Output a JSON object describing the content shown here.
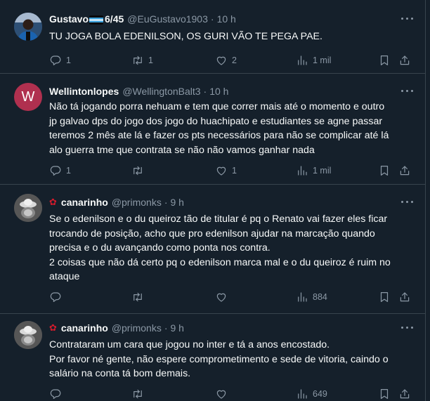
{
  "tweets": [
    {
      "name_pre": "Gustavo",
      "name_post": "6/45",
      "name_has_flag": true,
      "handle": "@EuGustavo1903",
      "time": "10 h",
      "lines": [
        "TU JOGA BOLA EDENILSON, OS GURI VÃO TE PEGA PAE."
      ],
      "replies": "1",
      "retweets": "1",
      "likes": "2",
      "views": "1 mil"
    },
    {
      "name": "Wellintonlopes",
      "avatar_letter": "W",
      "handle": "@WellingtonBalt3",
      "time": "10 h",
      "lines": [
        "Não tá jogando porra nehuam e tem que correr mais até o momento e outro",
        "jp galvao dps do jogo dos jogo do huachipato e estudiantes se agne passar",
        "teremos 2 mês ate lá e fazer os pts necessários para não se complicar até lá",
        "alo guerra tme que contrata se não não vamos ganhar nada"
      ],
      "replies": "1",
      "retweets": "",
      "likes": "1",
      "views": "1 mil"
    },
    {
      "name": "canarinho",
      "handle": "@primonks",
      "time": "9 h",
      "lines": [
        "Se o edenilson e o du queiroz tão de titular é pq o Renato vai fazer eles ficar",
        "trocando de posição, acho que pro edenilson ajudar na marcação quando",
        "precisa e o du avançando como ponta nos contra.",
        "2 coisas que não dá certo pq o edenilson marca mal e o du queiroz é ruim no",
        "ataque"
      ],
      "replies": "",
      "retweets": "",
      "likes": "",
      "views": "884"
    },
    {
      "name": "canarinho",
      "handle": "@primonks",
      "time": "9 h",
      "lines": [
        "Contrataram um cara que jogou no inter e tá a anos encostado.",
        "Por favor né gente, não espere comprometimento e sede de vitoria, caindo o",
        "salário na conta tá bom demais."
      ],
      "replies": "",
      "retweets": "",
      "likes": "",
      "views": "649"
    }
  ],
  "separator": "·",
  "colors": {
    "background": "#15202b",
    "text": "#f7f9f9",
    "muted": "#8b98a5",
    "border": "#38444d",
    "avatar_w": "#b0304f",
    "rose": "#d11b2c"
  },
  "icons": [
    "reply-icon",
    "retweet-icon",
    "like-icon",
    "views-icon",
    "bookmark-icon",
    "share-icon",
    "more-icon",
    "rose-icon",
    "flag-icon"
  ]
}
